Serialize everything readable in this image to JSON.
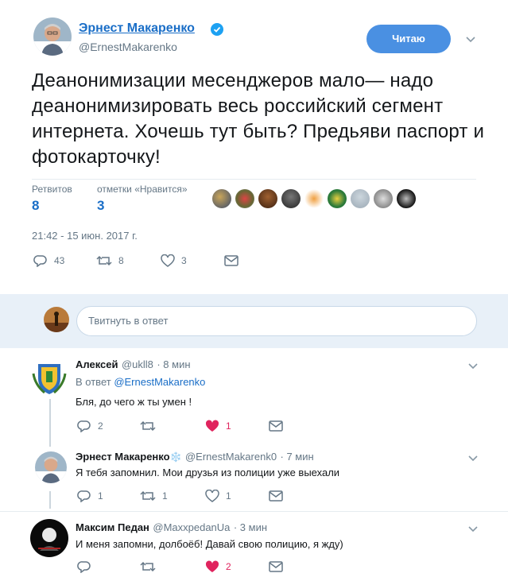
{
  "tweet": {
    "author_name": "Эрнест Макаренко",
    "author_handle": "@ErnestMakarenko",
    "follow_label": "Читаю",
    "text": "Деанонимизации месенджеров мало— надо деанонимизировать весь российский сегмент интернета. Хочешь тут быть? Предьяви паспорт и фотокарточку!",
    "retweets_label": "Ретвитов",
    "retweets_value": "8",
    "likes_label": "отметки «Нравится»",
    "likes_value": "3",
    "timestamp": "21:42 - 15 июн. 2017 г.",
    "actions": {
      "reply_count": "43",
      "retweet_count": "8",
      "like_count": "3"
    }
  },
  "reply_box": {
    "placeholder": "Твитнуть в ответ"
  },
  "replies": [
    {
      "name": "Алексей",
      "handle": "@ukll8",
      "time": "· 8 мин",
      "in_reply_prefix": "В ответ ",
      "in_reply_handle": "@ErnestMakarenko",
      "text": "Бля, до чего ж ты умен !",
      "reply_count": "2",
      "retweet_count": "",
      "like_count": "1"
    },
    {
      "name": "Эрнест Макаренко",
      "snowflake": "❄️",
      "handle": "@ErnestMakarenk0",
      "time": "· 7 мин",
      "text": "Я тебя запомнил. Мои друзья из полиции уже выехали",
      "reply_count": "1",
      "retweet_count": "1",
      "like_count": "1"
    },
    {
      "name": "Максим Педан",
      "handle": "@MaxxpedanUa",
      "time": "· 3 мин",
      "text": "И меня запомни, долбоёб! Давай свою полицию, я жду)",
      "reply_count": "",
      "retweet_count": "",
      "like_count": "2"
    }
  ],
  "colors": {
    "accent": "#1a6ec7",
    "button": "#4a90e2",
    "heart": "#e0245e",
    "muted": "#657786",
    "reply_bg": "#e8f0f8"
  }
}
